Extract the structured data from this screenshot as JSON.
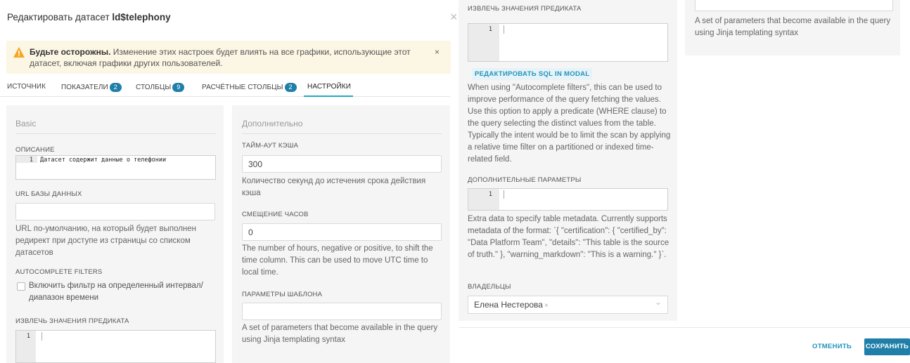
{
  "modal": {
    "title_prefix": "Редактировать датасет ",
    "title_dataset": "ld$telephony",
    "close_glyph": "×"
  },
  "alert": {
    "bold": "Будьте осторожны.",
    "text": " Изменение этих настроек будет влиять на все графики, использующие этот датасет, включая графики других пользователей.",
    "close_glyph": "×",
    "color": "#f5a623"
  },
  "tabs": [
    {
      "label": "ИСТОЧНИК",
      "badge": ""
    },
    {
      "label": "ПОКАЗАТЕЛИ",
      "badge": "2"
    },
    {
      "label": "СТОЛБЦЫ",
      "badge": "9"
    },
    {
      "label": "РАСЧЁТНЫЕ СТОЛБЦЫ",
      "badge": "2"
    },
    {
      "label": "НАСТРОЙКИ",
      "badge": ""
    }
  ],
  "basic": {
    "title": "Basic",
    "description_label": "ОПИСАНИЕ",
    "description_line_no": "1",
    "description_value": "Датасет содержит данные о телефонии",
    "url_label": "URL БАЗЫ ДАННЫХ",
    "url_value": "",
    "url_help": "URL по-умолчанию, на который будет выполнен редирект при доступе из страницы со списком датасетов",
    "autocomplete_label": "AUTOCOMPLETE FILTERS",
    "autocomplete_checkbox": "Включить фильтр на определенный интервал/ диапазон времени",
    "predicate_label": "ИЗВЛЕЧЬ ЗНАЧЕНИЯ ПРЕДИКАТА",
    "predicate_line_no": "1"
  },
  "advanced": {
    "title": "Дополнительно",
    "cache_label": "ТАЙМ-АУТ КЭША",
    "cache_value": "300",
    "cache_help": "Количество секунд до истечения срока действия кэша",
    "offset_label": "СМЕЩЕНИЕ ЧАСОВ",
    "offset_value": "0",
    "offset_help": "The number of hours, negative or positive, to shift the time column. This can be used to move UTC time to local time.",
    "template_label": "ПАРАМЕТРЫ ШАБЛОНА",
    "template_value": "",
    "template_help": "A set of parameters that become available in the query using Jinja templating syntax"
  },
  "right": {
    "predicate_label": "ИЗВЛЕЧЬ ЗНАЧЕНИЯ ПРЕДИКАТА",
    "predicate_line_no": "1",
    "edit_sql_button": "РЕДАКТИРОВАТЬ SQL IN MODAL",
    "predicate_help": "When using \"Autocomplete filters\", this can be used to improve performance of the query fetching the values. Use this option to apply a predicate (WHERE clause) to the query selecting the distinct values from the table. Typically the intent would be to limit the scan by applying a relative time filter on a partitioned or indexed time-related field.",
    "extra_label": "ДОПОЛНИТЕЛЬНЫЕ ПАРАМЕТРЫ",
    "extra_line_no": "1",
    "extra_help": "Extra data to specify table metadata. Currently supports metadata of the format: `{ \"certification\": { \"certified_by\": \"Data Platform Team\", \"details\": \"This table is the source of truth.\" }, \"warning_markdown\": \"This is a warning.\" }`.",
    "owners_label": "ВЛАДЕЛЬЦЫ",
    "owner_tag": "Елена Нестерова",
    "tag_remove_glyph": "×",
    "chevron_glyph": "⌄",
    "far_template_help": "A set of parameters that become available in the query using Jinja templating syntax"
  },
  "footer": {
    "cancel": "ОТМЕНИТЬ",
    "save": "СОХРАНИТЬ"
  },
  "colors": {
    "accent": "#20a7c9",
    "primary": "#1f7fa8",
    "link": "#2393bd"
  }
}
